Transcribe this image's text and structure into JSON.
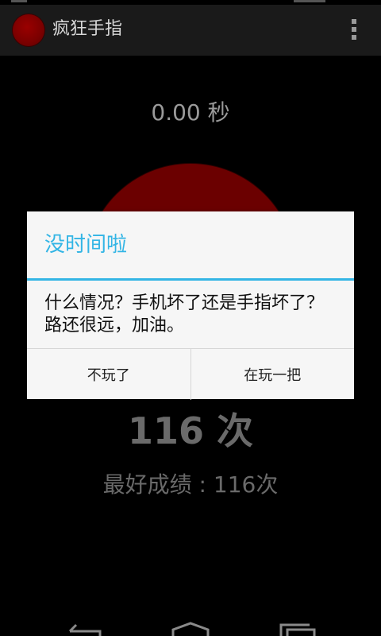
{
  "action_bar": {
    "title": "疯狂手指",
    "icon": "red-circle-icon",
    "menu_icon": "overflow-menu-icon"
  },
  "game": {
    "timer": "0.00 秒",
    "count": "116 次",
    "best": "最好成绩 : 116次",
    "button_color": "#6b0000"
  },
  "dialog": {
    "title": "没时间啦",
    "message": "什么情况？手机坏了还是手指坏了？路还很远，加油。",
    "negative_button": "不玩了",
    "positive_button": "在玩一把",
    "accent_color": "#33b5e5"
  },
  "nav_bar": {
    "back_icon": "back-icon",
    "home_icon": "home-icon",
    "recents_icon": "recents-icon"
  }
}
